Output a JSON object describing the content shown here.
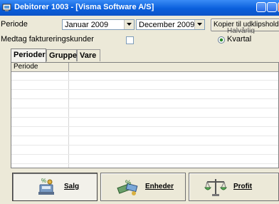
{
  "window": {
    "title": "Debitorer 1003 - [Visma Software A/S]"
  },
  "period": {
    "label": "Periode",
    "from_value": "Januar 2009",
    "to_value": "December 2009"
  },
  "copy_button": {
    "label": "Kopier til udklipsholder"
  },
  "include_invoice": {
    "label": "Medtag faktureringskunder",
    "checked": false
  },
  "granularity": {
    "options": [
      "Halvårlig",
      "Kvartal"
    ],
    "selected": "Kvartal"
  },
  "tabs": [
    {
      "label": "Perioder",
      "active": true
    },
    {
      "label": "Gruppe",
      "active": false
    },
    {
      "label": "Vare",
      "active": false
    }
  ],
  "grid": {
    "columns": [
      "Periode",
      ""
    ],
    "rows": []
  },
  "actions": [
    {
      "label": "Salg",
      "icon": "sales-icon",
      "pressed": true
    },
    {
      "label": "Enheder",
      "icon": "units-icon",
      "pressed": false
    },
    {
      "label": "Profit",
      "icon": "profit-scale-icon",
      "pressed": false
    }
  ],
  "colors": {
    "titlebar": "#0a5fdc",
    "window_bg": "#ece9d8"
  }
}
